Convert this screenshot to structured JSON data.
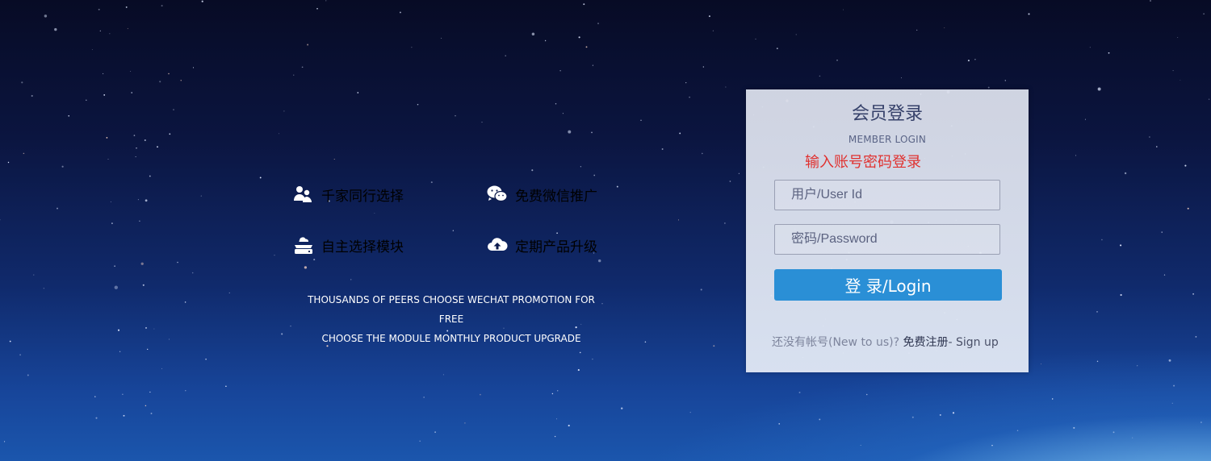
{
  "features": [
    {
      "icon": "users-icon",
      "label": "千家同行选择"
    },
    {
      "icon": "wechat-icon",
      "label": "免费微信推广"
    },
    {
      "icon": "module-icon",
      "label": "自主选择模块"
    },
    {
      "icon": "cloud-upload-icon",
      "label": "定期产品升级"
    }
  ],
  "tagline": {
    "line1": "THOUSANDS OF PEERS CHOOSE WECHAT PROMOTION FOR FREE",
    "line2": "CHOOSE THE MODULE MONTHLY PRODUCT UPGRADE"
  },
  "login": {
    "title": "会员登录",
    "subtitle": "MEMBER LOGIN",
    "hint": "输入账号密码登录",
    "username_placeholder": "用户/User Id",
    "password_placeholder": "密码/Password",
    "submit_label": "登 录/Login",
    "signup_prompt": "还没有帐号(New to us)?",
    "signup_link": "免费注册",
    "signup_en": "- Sign up"
  },
  "colors": {
    "accent": "#2a8fd6",
    "hint": "#e0312f",
    "title": "#36416a"
  }
}
